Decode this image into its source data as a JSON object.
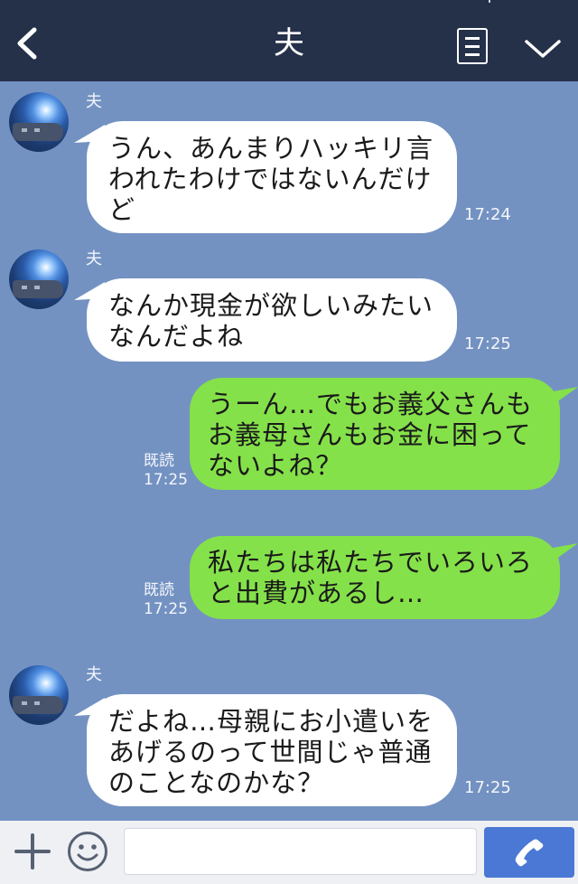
{
  "header": {
    "title": "夫",
    "back_icon": "chevron-left-icon",
    "menu_icon": "menu-icon",
    "more_icon": "chevron-down-icon"
  },
  "messages": [
    {
      "side": "left",
      "sender": "夫",
      "lines": [
        "うん、あんまりハッキリ言",
        "われたわけではないんだけ",
        "ど"
      ],
      "time": "17:24"
    },
    {
      "side": "left",
      "sender": "夫",
      "lines": [
        "なんか現金が欲しいみたい",
        "なんだよね"
      ],
      "time": "17:25"
    },
    {
      "side": "right",
      "read": "既読",
      "lines": [
        "うーん…でもお義父さんも",
        "お義母さんもお金に困って",
        "ないよね？"
      ],
      "time": "17:25"
    },
    {
      "side": "right",
      "read": "既読",
      "lines": [
        "私たちは私たちでいろいろ",
        "と出費があるし…"
      ],
      "time": "17:25"
    },
    {
      "side": "left",
      "sender": "夫",
      "lines": [
        "だよね…母親にお小遣いを",
        "あげるのって世間じゃ普通",
        "のことなのかな？"
      ],
      "time": "17:25"
    }
  ],
  "footer": {
    "add_icon": "plus-icon",
    "sticker_icon": "smiley-icon",
    "input_value": "",
    "call_icon": "phone-icon"
  },
  "colors": {
    "header": "#253049",
    "chat_bg": "#7392c2",
    "bubble_in": "#ffffff",
    "bubble_out": "#85e14a",
    "call_button": "#4a78d4"
  }
}
